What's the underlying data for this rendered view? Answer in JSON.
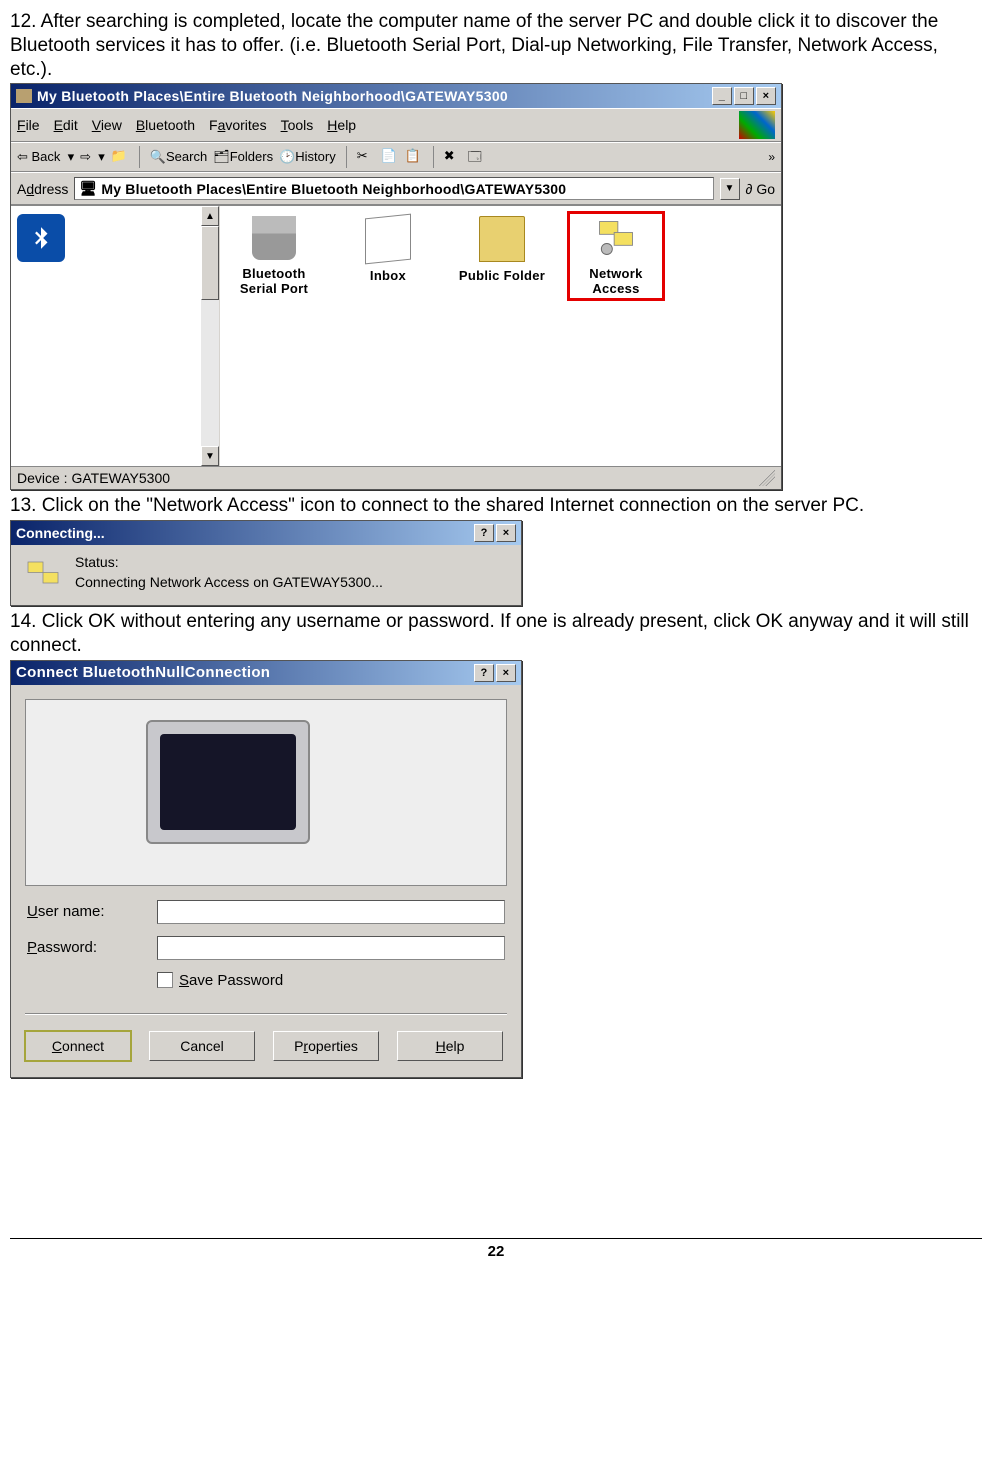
{
  "step12": "12. After searching is completed, locate the computer name of the server PC and double click it to discover the Bluetooth services it has to offer. (i.e. Bluetooth Serial Port, Dial-up Networking, File Transfer, Network Access, etc.).",
  "step13": "13. Click on the \"Network Access\" icon to connect to the shared Internet connection on the server PC.",
  "step14": "14. Click OK without entering any username or password. If one is already present, click OK anyway and it will still connect.",
  "page_number": "22",
  "win1": {
    "title": "My Bluetooth Places\\Entire Bluetooth Neighborhood\\GATEWAY5300",
    "menu": {
      "file": "File",
      "edit": "Edit",
      "view": "View",
      "bluetooth": "Bluetooth",
      "favorites": "Favorites",
      "tools": "Tools",
      "help": "Help"
    },
    "toolbar": {
      "back": "Back",
      "search": "Search",
      "folders": "Folders",
      "history": "History"
    },
    "address_label": "Address",
    "address_value": "My Bluetooth Places\\Entire Bluetooth Neighborhood\\GATEWAY5300",
    "go": "Go",
    "icons": {
      "serial": "Bluetooth Serial Port",
      "inbox": "Inbox",
      "public": "Public Folder",
      "network": "Network Access"
    },
    "status": "Device : GATEWAY5300"
  },
  "win2": {
    "title": "Connecting...",
    "status_label": "Status:",
    "status_text": "Connecting Network Access on GATEWAY5300..."
  },
  "win3": {
    "title": "Connect BluetoothNullConnection",
    "field_user": "User name:",
    "field_pass": "Password:",
    "save_pw": "Save Password",
    "btn_connect": "Connect",
    "btn_cancel": "Cancel",
    "btn_props": "Properties",
    "btn_help": "Help"
  }
}
